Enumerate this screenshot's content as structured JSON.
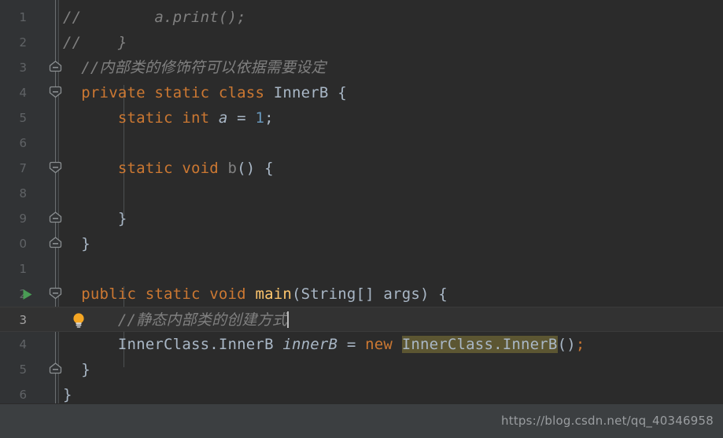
{
  "editor": {
    "theme": "darcula",
    "background_color": "#2b2b2b",
    "gutter_color": "#313335",
    "current_line_color": "#323232",
    "selection_highlight_color": "#5c5632",
    "clipped_top_line": {
      "left_fragment": "//",
      "right_fragment": "();"
    },
    "lines": [
      {
        "number": "1",
        "text": "//        a.print();",
        "fold": null,
        "run_icon": false,
        "bulb": false,
        "current": false,
        "tokens": [
          {
            "t": "//        a.print();",
            "c": "comment"
          }
        ]
      },
      {
        "number": "2",
        "text": "//    }",
        "fold": null,
        "run_icon": false,
        "bulb": false,
        "current": false,
        "tokens": [
          {
            "t": "//    }",
            "c": "comment"
          }
        ]
      },
      {
        "number": "3",
        "text": "  //内部类的修饰符可以依据需要设定",
        "fold": "collapse",
        "run_icon": false,
        "bulb": false,
        "current": false,
        "tokens": [
          {
            "t": "  //内部类的修饰符可以依据需要设定",
            "c": "comment"
          }
        ]
      },
      {
        "number": "4",
        "text": "  private static class InnerB {",
        "fold": "expand",
        "run_icon": false,
        "bulb": false,
        "current": false,
        "tokens": [
          {
            "t": "  ",
            "c": "punct"
          },
          {
            "t": "private",
            "c": "kw"
          },
          {
            "t": " ",
            "c": "punct"
          },
          {
            "t": "static",
            "c": "kw"
          },
          {
            "t": " ",
            "c": "punct"
          },
          {
            "t": "class",
            "c": "kw"
          },
          {
            "t": " ",
            "c": "punct"
          },
          {
            "t": "InnerB",
            "c": "cls"
          },
          {
            "t": " {",
            "c": "punct"
          }
        ]
      },
      {
        "number": "5",
        "text": "      static int a = 1;",
        "fold": null,
        "run_icon": false,
        "bulb": false,
        "current": false,
        "tokens": [
          {
            "t": "      ",
            "c": "punct"
          },
          {
            "t": "static",
            "c": "kw"
          },
          {
            "t": " ",
            "c": "punct"
          },
          {
            "t": "int",
            "c": "kw"
          },
          {
            "t": " ",
            "c": "punct"
          },
          {
            "t": "a",
            "c": "localv"
          },
          {
            "t": " = ",
            "c": "punct"
          },
          {
            "t": "1",
            "c": "num"
          },
          {
            "t": ";",
            "c": "punct"
          }
        ]
      },
      {
        "number": "6",
        "text": "",
        "fold": null,
        "run_icon": false,
        "bulb": false,
        "current": false,
        "tokens": []
      },
      {
        "number": "7",
        "text": "      static void b() {",
        "fold": "expand",
        "run_icon": false,
        "bulb": false,
        "current": false,
        "tokens": [
          {
            "t": "      ",
            "c": "punct"
          },
          {
            "t": "static",
            "c": "kw"
          },
          {
            "t": " ",
            "c": "punct"
          },
          {
            "t": "void",
            "c": "kw"
          },
          {
            "t": " ",
            "c": "punct"
          },
          {
            "t": "b",
            "c": "gray"
          },
          {
            "t": "() {",
            "c": "punct"
          }
        ]
      },
      {
        "number": "8",
        "text": "",
        "fold": null,
        "run_icon": false,
        "bulb": false,
        "current": false,
        "tokens": []
      },
      {
        "number": "9",
        "text": "      }",
        "fold": "collapse",
        "run_icon": false,
        "bulb": false,
        "current": false,
        "tokens": [
          {
            "t": "      }",
            "c": "punct"
          }
        ]
      },
      {
        "number": "0",
        "text": "  }",
        "fold": "collapse",
        "run_icon": false,
        "bulb": false,
        "current": false,
        "tokens": [
          {
            "t": "  }",
            "c": "punct"
          }
        ]
      },
      {
        "number": "1",
        "text": "",
        "fold": null,
        "run_icon": false,
        "bulb": false,
        "current": false,
        "tokens": []
      },
      {
        "number": "2",
        "text": "  public static void main(String[] args) {",
        "fold": "expand",
        "run_icon": true,
        "bulb": false,
        "current": false,
        "tokens": [
          {
            "t": "  ",
            "c": "punct"
          },
          {
            "t": "public",
            "c": "kw"
          },
          {
            "t": " ",
            "c": "punct"
          },
          {
            "t": "static",
            "c": "kw"
          },
          {
            "t": " ",
            "c": "punct"
          },
          {
            "t": "void",
            "c": "kw"
          },
          {
            "t": " ",
            "c": "punct"
          },
          {
            "t": "main",
            "c": "meth"
          },
          {
            "t": "(",
            "c": "punct"
          },
          {
            "t": "String",
            "c": "cls"
          },
          {
            "t": "[] ",
            "c": "punct"
          },
          {
            "t": "args",
            "c": "ident"
          },
          {
            "t": ") {",
            "c": "punct"
          }
        ]
      },
      {
        "number": "3",
        "text": "      //静态内部类的创建方式",
        "fold": null,
        "run_icon": false,
        "bulb": true,
        "current": true,
        "caret_after": true,
        "tokens": [
          {
            "t": "      //静态内部类的创建方式",
            "c": "comment"
          }
        ]
      },
      {
        "number": "4",
        "text": "      InnerClass.InnerB innerB = new InnerClass.InnerB();",
        "fold": null,
        "run_icon": false,
        "bulb": false,
        "current": false,
        "tokens": [
          {
            "t": "      ",
            "c": "punct"
          },
          {
            "t": "InnerClass",
            "c": "cls"
          },
          {
            "t": ".",
            "c": "punct"
          },
          {
            "t": "InnerB",
            "c": "cls"
          },
          {
            "t": " ",
            "c": "punct"
          },
          {
            "t": "innerB",
            "c": "localv"
          },
          {
            "t": " = ",
            "c": "punct"
          },
          {
            "t": "new",
            "c": "kw"
          },
          {
            "t": " ",
            "c": "punct"
          },
          {
            "t": "InnerClass",
            "c": "cls",
            "hl": true
          },
          {
            "t": ".",
            "c": "punct",
            "hl": true
          },
          {
            "t": "InnerB",
            "c": "cls",
            "hl": true
          },
          {
            "t": "()",
            "c": "punct"
          },
          {
            "t": ";",
            "c": "kw"
          }
        ]
      },
      {
        "number": "5",
        "text": "  }",
        "fold": "collapse",
        "run_icon": false,
        "bulb": false,
        "current": false,
        "tokens": [
          {
            "t": "  }",
            "c": "punct"
          }
        ]
      },
      {
        "number": "6",
        "text": "}",
        "fold": null,
        "run_icon": false,
        "bulb": false,
        "current": false,
        "tokens": [
          {
            "t": "}",
            "c": "punct"
          }
        ]
      }
    ]
  },
  "status_bar": {
    "watermark": "https://blog.csdn.net/qq_40346958"
  },
  "icons": {
    "run": "run-triangle-icon",
    "bulb": "lightbulb-intention-icon",
    "fold_expand": "fold-expand-icon",
    "fold_collapse": "fold-collapse-icon"
  }
}
